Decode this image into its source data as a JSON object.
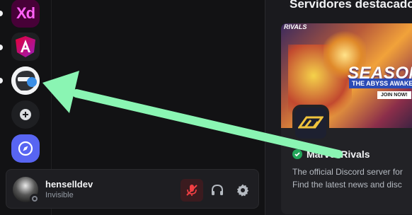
{
  "server_rail": {
    "servers": [
      {
        "name": "adobe-xd",
        "label": "Xd",
        "icon": "adobe-xd-icon"
      },
      {
        "name": "angular",
        "icon": "angular-icon"
      },
      {
        "name": "bot-server",
        "icon": "helmet-icon"
      },
      {
        "name": "add-server",
        "icon": "plus-icon"
      },
      {
        "name": "discover",
        "icon": "compass-icon"
      }
    ]
  },
  "featured": {
    "section_title": "Servidores destacados",
    "card": {
      "banner_logo": "RIVALS",
      "banner_headline": "SEASON",
      "banner_sub": "THE ABYSS AWAKENS",
      "banner_cta": "JOIN NOW!",
      "server_name": "Marvel Rivals",
      "description_lines": [
        "The official Discord server for",
        "Find the latest news and disc"
      ]
    }
  },
  "user_panel": {
    "username": "henselldev",
    "status": "Invisible",
    "controls": [
      "microphone-muted-icon",
      "headphones-icon",
      "gear-icon"
    ]
  },
  "colors": {
    "accent": "#5865f2",
    "muted_red": "#f23f43",
    "verified_green": "#23a55a",
    "annotation_arrow": "#8af5b3"
  }
}
